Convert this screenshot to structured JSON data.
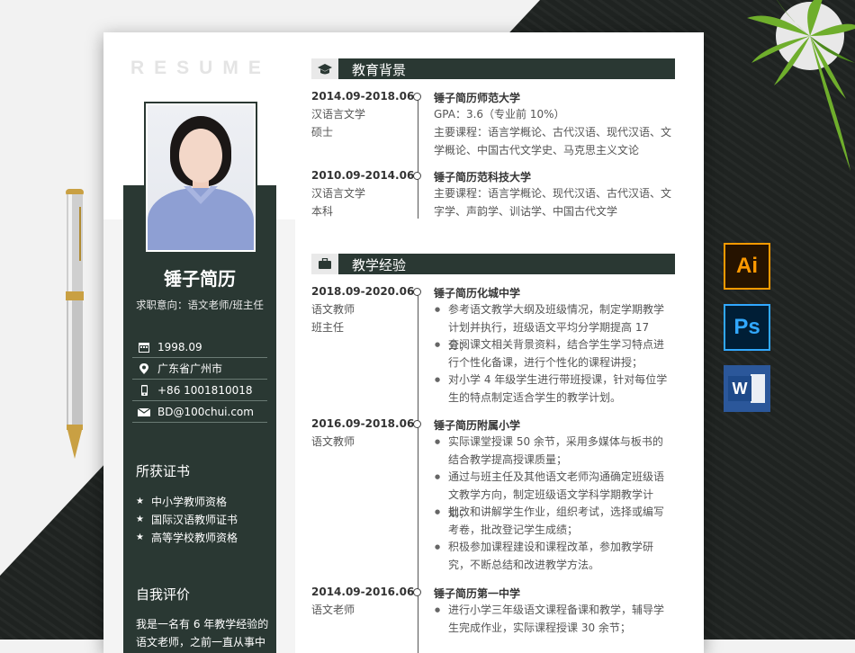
{
  "cover": {
    "resume_word": "RESUME"
  },
  "profile": {
    "name": "锤子简历",
    "intent": "求职意向：语文老师/班主任",
    "birth": "1998.09",
    "location": "广东省广州市",
    "phone": "+86 1001810018",
    "email": "BD@100chui.com"
  },
  "certificates": {
    "title": "所获证书",
    "items": [
      "中小学教师资格",
      "国际汉语教师证书",
      "高等学校教师资格"
    ]
  },
  "self_eval": {
    "title": "自我评价",
    "text": "我是一名有 6 年教学经验的语文老师，之前一直从事中"
  },
  "education": {
    "title": "教育背景",
    "entries": [
      {
        "date": "2014.09-2018.06",
        "major": "汉语言文学",
        "degree": "硕士",
        "school": "锤子简历师范大学",
        "gpa": "GPA：3.6（专业前 10%）",
        "courses": "主要课程：语言学概论、古代汉语、现代汉语、文学概论、中国古代文学史、马克思主义文论"
      },
      {
        "date": "2010.09-2014.06",
        "major": "汉语言文学",
        "degree": "本科",
        "school": "锤子简历范科技大学",
        "courses": "主要课程：语言学概论、现代汉语、古代汉语、文字学、声韵学、训诂学、中国古代文学"
      }
    ]
  },
  "experience": {
    "title": "教学经验",
    "entries": [
      {
        "date": "2018.09-2020.06",
        "role1": "语文教师",
        "role2": "班主任",
        "school": "锤子简历化城中学",
        "bullets": [
          "参考语文教学大纲及班级情况，制定学期教学计划并执行，班级语文平均分学期提高 17 分；",
          "查阅课文相关背景资料，结合学生学习特点进行个性化备课，进行个性化的课程讲授；",
          "对小学 4 年级学生进行带班授课，针对每位学生的特点制定适合学生的教学计划。"
        ]
      },
      {
        "date": "2016.09-2018.06",
        "role1": "语文教师",
        "school": "锤子简历附属小学",
        "bullets": [
          "实际课堂授课 50 余节，采用多媒体与板书的结合教学提高授课质量；",
          "通过与班主任及其他语文老师沟通确定班级语文教学方向，制定班级语文学科学期教学计划；",
          "批改和讲解学生作业，组织考试，选择或编写考卷，批改登记学生成绩；",
          "积极参加课程建设和课程改革，参加教学研究，不断总结和改进教学方法。"
        ]
      },
      {
        "date": "2014.09-2016.06",
        "role1": "语文老师",
        "school": "锤子简历第一中学",
        "bullets": [
          "进行小学三年级语文课程备课和教学，辅导学生完成作业，实际课程授课 30 余节；"
        ]
      }
    ]
  },
  "apps": {
    "ai": "Ai",
    "ps": "Ps",
    "word": "W"
  },
  "colors": {
    "sidebar": "#2a3833",
    "background_dark": "#1f2321",
    "ai": "#ff9a00",
    "ps": "#31a8ff",
    "word": "#2b579a"
  }
}
